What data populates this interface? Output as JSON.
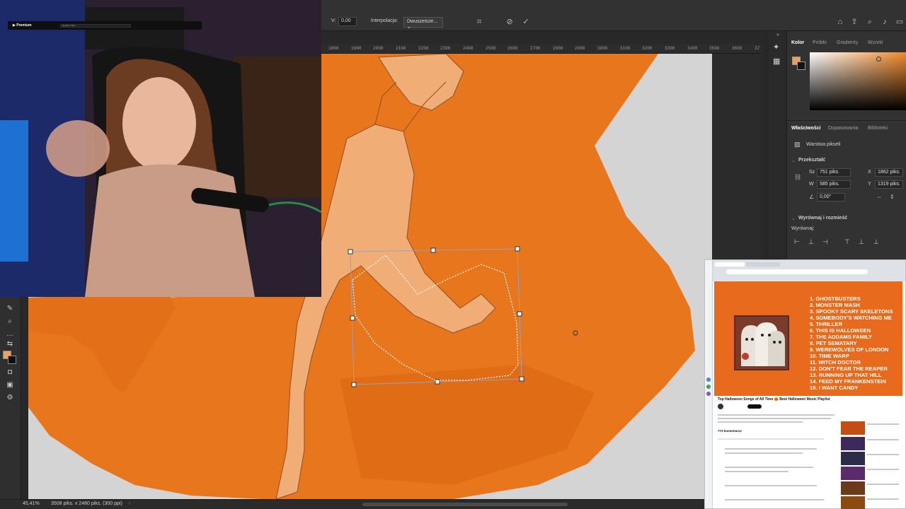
{
  "options_bar": {
    "v_label": "V:",
    "v_value": "0,00",
    "interpolation_label": "Interpolacja:",
    "interpolation_value": "Dwuszeście..."
  },
  "ruler": {
    "ticks": [
      "1800",
      "1900",
      "2000",
      "2100",
      "2200",
      "2300",
      "2400",
      "2500",
      "2600",
      "2700",
      "2800",
      "2900",
      "3000",
      "3100",
      "3200",
      "3300",
      "3400",
      "3500",
      "3600",
      "37"
    ]
  },
  "color_panel": {
    "tabs": [
      "Kolor",
      "Próbki",
      "Gradienty",
      "Wzorki"
    ],
    "foreground": "#f0a05a",
    "background": "#1a1a1a"
  },
  "properties_panel": {
    "tabs": [
      "Właściwości",
      "Dopasowania",
      "Biblioteki"
    ],
    "layer_type": "Warstwa pikseli",
    "transform_heading": "Przekształć",
    "width_label": "Sz",
    "width_value": "751 piks.",
    "height_label": "W",
    "height_value": "585 piks.",
    "x_label": "X",
    "x_value": "1862 piks.",
    "y_label": "Y",
    "y_value": "1319 piks.",
    "angle_value": "0,00°",
    "align_heading": "Wyrównaj i rozmieść",
    "align_label": "Wyrównaj:"
  },
  "status_bar": {
    "zoom": "45,41%",
    "doc_info": "3508 piks. x 2480 piks. (300 ppi)"
  },
  "browser": {
    "yt_logo": "▶ Premium",
    "search": "spooky music",
    "video_title": "Top Halloween Songs of All Time 🎃 Best Halloween Music Playlist",
    "comments_count": "774 komentarze",
    "songs": [
      "1. GHOSTBUSTERS",
      "2. MONSTER MASH",
      "3. SPOOKY SCARY SKELETONS",
      "4. SOMEBODY'S WATCHING ME",
      "5. THRILLER",
      "6. THIS IS HALLOWEEN",
      "7. THE ADDAMS FAMILY",
      "8. PET SEMATARY",
      "9. WEREWOLVES OF LONDON",
      "10. TIME WARP",
      "11. WITCH DOCTOR",
      "12. DON'T FEAR THE REAPER",
      "13. RUNNING UP THAT HILL",
      "14. FEED MY FRANKENSTEIN",
      "15. I WANT CANDY"
    ]
  },
  "colors": {
    "blob_orange": "#e7761d",
    "sketch_skin": "#f1b37e",
    "video_orange": "#e86a1c",
    "ui_dark": "#323232"
  }
}
